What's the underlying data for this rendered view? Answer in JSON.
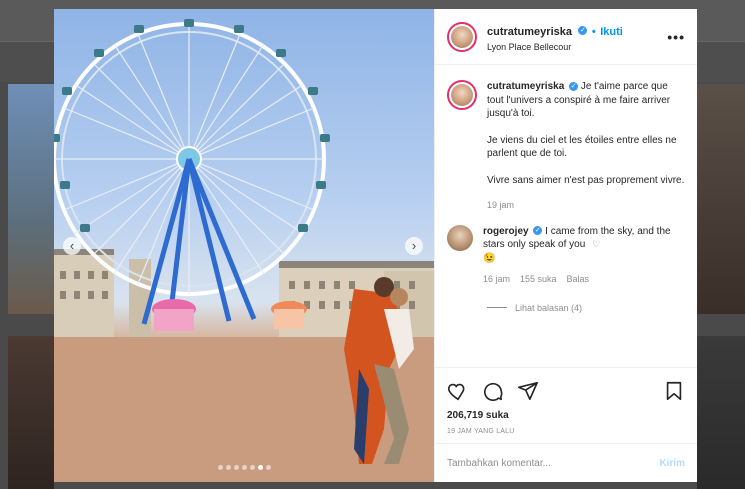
{
  "post": {
    "username": "cutratumeyriska",
    "follow_label": "Ikuti",
    "bullet": "•",
    "location": "Lyon Place Bellecour",
    "more_label": "•••",
    "caption": {
      "username": "cutratumeyriska",
      "line1": "Je t'aime parce que tout l'univers a conspiré à me faire arriver jusqu'à toi.",
      "line2": "Je viens du ciel et les étoiles entre elles ne parlent que de toi.",
      "line3": "Vivre sans aimer n'est pas proprement vivre.",
      "time": "19 jam"
    },
    "comment": {
      "username": "rogerojey",
      "text": "I came from the sky, and the stars only speak of you",
      "emoji": "😉",
      "time": "16 jam",
      "likes": "155 suka",
      "reply_label": "Balas",
      "view_replies": "Lihat balasan (4)"
    },
    "likes": "206,719 suka",
    "timestamp": "19 JAM YANG LALU",
    "comment_placeholder": "Tambahkan komentar...",
    "post_label": "Kirim"
  },
  "carousel": {
    "prev": "‹",
    "next": "›",
    "count": 7,
    "active": 5
  },
  "colors": {
    "accent": "#0095f6",
    "verified": "#3897f0",
    "muted": "#8e8e8e",
    "ring": "#e1306c"
  },
  "icons": [
    "heart-icon",
    "comment-icon",
    "share-icon",
    "bookmark-icon",
    "verified-icon"
  ]
}
